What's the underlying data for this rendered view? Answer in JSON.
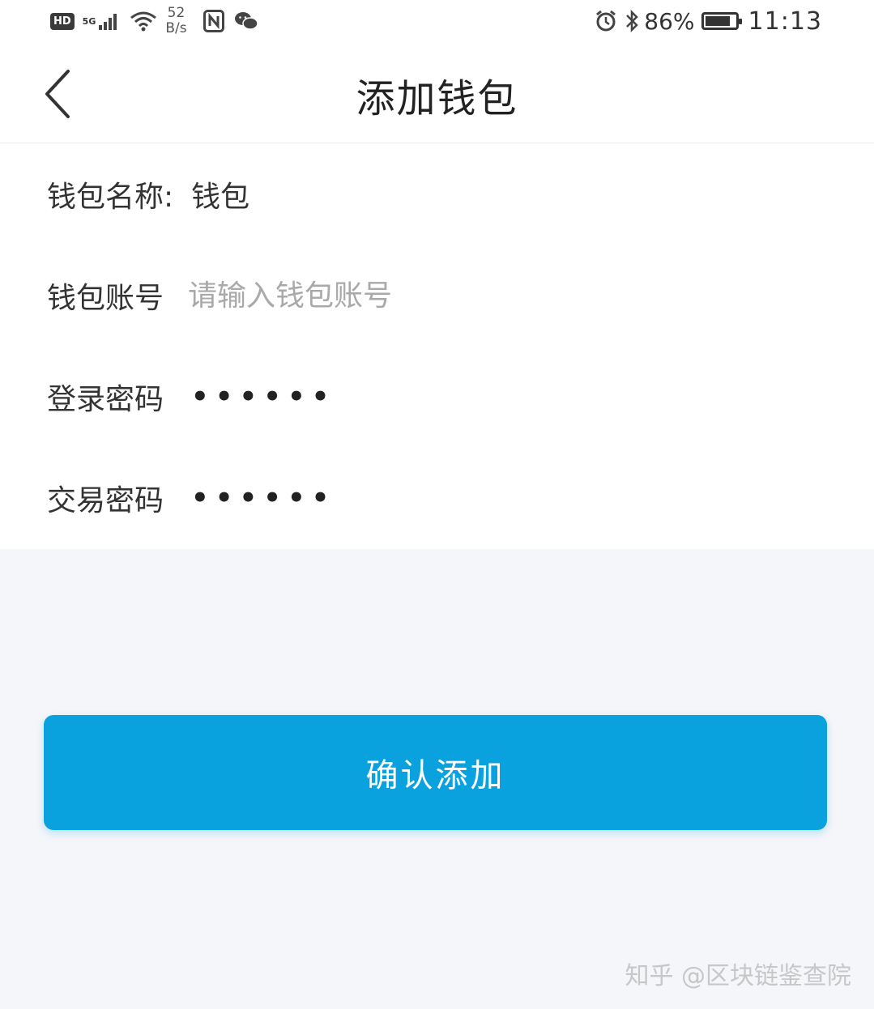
{
  "status_bar": {
    "hd_badge": "HD",
    "network_type": "5G",
    "speed_value": "52",
    "speed_unit": "B/s",
    "battery_percent": "86%",
    "battery_level": 0.86,
    "time": "11:13"
  },
  "header": {
    "title": "添加钱包"
  },
  "form": {
    "wallet_name": {
      "label": "钱包名称:",
      "value": "钱包"
    },
    "wallet_account": {
      "label": "钱包账号",
      "value": "",
      "placeholder": "请输入钱包账号"
    },
    "login_password": {
      "label": "登录密码",
      "masked": "••••••"
    },
    "trade_password": {
      "label": "交易密码",
      "masked": "••••••"
    }
  },
  "confirm_button": {
    "label": "确认添加"
  },
  "watermark": {
    "text": "知乎 @区块链鉴查院"
  },
  "colors": {
    "accent": "#0aa2de",
    "background": "#f5f6fa",
    "surface": "#ffffff",
    "text": "#333333",
    "placeholder": "#a9a9a9"
  },
  "icons": {
    "back": "chevron-left-icon",
    "wifi": "wifi-icon",
    "nfc": "nfc-icon",
    "wechat": "wechat-icon",
    "alarm": "alarm-icon",
    "bluetooth": "bluetooth-icon",
    "battery": "battery-icon",
    "signal": "signal-icon"
  }
}
